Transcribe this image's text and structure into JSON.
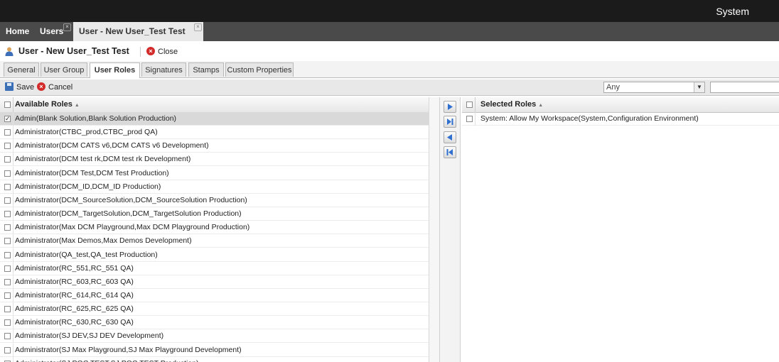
{
  "topbar": {
    "system_label": "System"
  },
  "navtabs": [
    {
      "label": "Home"
    },
    {
      "label": "Users",
      "close": "×"
    },
    {
      "label": "User - New User_Test Test",
      "close": "×"
    }
  ],
  "titlebar": {
    "title": "User - New User_Test Test",
    "close_label": "Close"
  },
  "subtabs": [
    {
      "label": "General"
    },
    {
      "label": "User Group"
    },
    {
      "label": "User Roles"
    },
    {
      "label": "Signatures"
    },
    {
      "label": "Stamps"
    },
    {
      "label": "Custom Properties"
    }
  ],
  "toolbar": {
    "save_label": "Save",
    "cancel_label": "Cancel",
    "filter_selected": "Any",
    "filter_arrow": "▼"
  },
  "available": {
    "header": "Available Roles",
    "sort": "▲",
    "rows": [
      {
        "label": "Admin(Blank Solution,Blank Solution Production)",
        "checked": true
      },
      {
        "label": "Administrator(CTBC_prod,CTBC_prod QA)"
      },
      {
        "label": "Administrator(DCM CATS v6,DCM CATS v6 Development)"
      },
      {
        "label": "Administrator(DCM test rk,DCM test rk Development)"
      },
      {
        "label": "Administrator(DCM Test,DCM Test Production)"
      },
      {
        "label": "Administrator(DCM_ID,DCM_ID Production)"
      },
      {
        "label": "Administrator(DCM_SourceSolution,DCM_SourceSolution Production)"
      },
      {
        "label": "Administrator(DCM_TargetSolution,DCM_TargetSolution Production)"
      },
      {
        "label": "Administrator(Max DCM Playground,Max DCM Playground Production)"
      },
      {
        "label": "Administrator(Max Demos,Max Demos Development)"
      },
      {
        "label": "Administrator(QA_test,QA_test Production)"
      },
      {
        "label": "Administrator(RC_551,RC_551 QA)"
      },
      {
        "label": "Administrator(RC_603,RC_603 QA)"
      },
      {
        "label": "Administrator(RC_614,RC_614 QA)"
      },
      {
        "label": "Administrator(RC_625,RC_625 QA)"
      },
      {
        "label": "Administrator(RC_630,RC_630 QA)"
      },
      {
        "label": "Administrator(SJ DEV,SJ DEV Development)"
      },
      {
        "label": "Administrator(SJ Max Playground,SJ Max Playground Development)"
      },
      {
        "label": "Administrator(SJ POC TEST,SJ POC TEST Production)"
      }
    ]
  },
  "selected": {
    "header": "Selected Roles",
    "sort": "▲",
    "rows": [
      {
        "label": "System: Allow My Workspace(System,Configuration Environment)"
      }
    ]
  },
  "transfer_buttons": [
    "move-right-icon",
    "move-all-right-icon",
    "move-left-icon",
    "move-all-left-icon"
  ],
  "colors": {
    "topbar": "#1b1b1b",
    "navtabs": "#4a4a4a",
    "arrow_blue": "#2f6fd0",
    "close_red": "#d32a2a"
  }
}
